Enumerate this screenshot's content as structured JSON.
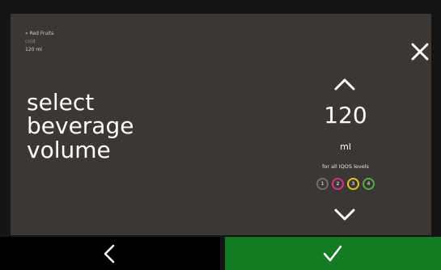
{
  "breadcrumb": {
    "beverage": "» Red Fruits",
    "temperature": "cold",
    "volume": "120 ml"
  },
  "title_lines": [
    "select",
    "beverage",
    "volume"
  ],
  "volume": {
    "value": "120",
    "unit": "ml",
    "note": "for all IQOS levels"
  },
  "levels": [
    {
      "label": "1",
      "color": "#6f6f6f"
    },
    {
      "label": "2",
      "color": "#d8318c"
    },
    {
      "label": "3",
      "color": "#e3c21b"
    },
    {
      "label": "4",
      "color": "#4fb043"
    }
  ],
  "icons": {
    "close": "close-icon",
    "increase": "chevron-up-icon",
    "decrease": "chevron-down-icon",
    "back": "chevron-left-icon",
    "confirm": "checkmark-icon"
  },
  "colors": {
    "panel": "#3a3734",
    "confirm": "#147a24",
    "back": "#000000"
  }
}
